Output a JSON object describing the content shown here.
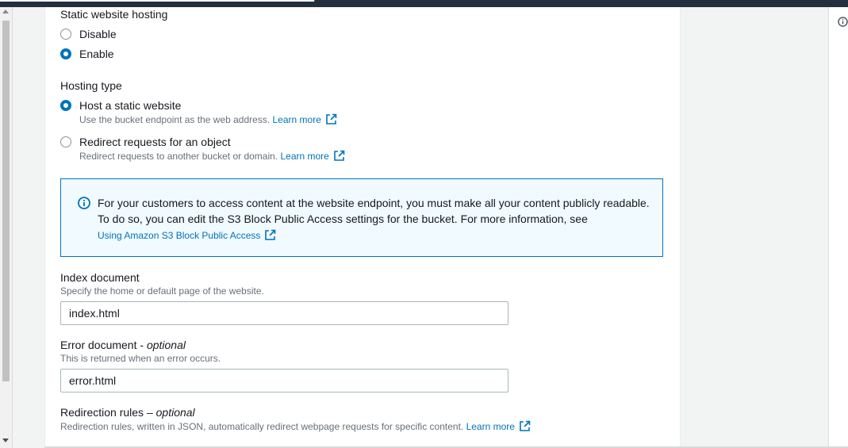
{
  "static_hosting": {
    "title": "Static website hosting",
    "options": [
      {
        "label": "Disable",
        "selected": false
      },
      {
        "label": "Enable",
        "selected": true
      }
    ]
  },
  "hosting_type": {
    "title": "Hosting type",
    "options": [
      {
        "label": "Host a static website",
        "description": "Use the bucket endpoint as the web address.",
        "link": "Learn more",
        "selected": true
      },
      {
        "label": "Redirect requests for an object",
        "description": "Redirect requests to another bucket or domain.",
        "link": "Learn more",
        "selected": false
      }
    ]
  },
  "alert": {
    "text": "For your customers to access content at the website endpoint, you must make all your content publicly readable. To do so, you can edit the S3 Block Public Access settings for the bucket. For more information, see",
    "link": "Using Amazon S3 Block Public Access",
    "icon": "info-icon",
    "color": "#0073bb"
  },
  "index_document": {
    "label": "Index document",
    "description": "Specify the home or default page of the website.",
    "value": "index.html"
  },
  "error_document": {
    "label": "Error document - ",
    "optional": "optional",
    "description": "This is returned when an error occurs.",
    "value": "error.html"
  },
  "redirection_rules": {
    "label": "Redirection rules – ",
    "optional": "optional",
    "description": "Redirection rules, written in JSON, automatically redirect webpage requests for specific content.",
    "link": "Learn more"
  },
  "colors": {
    "link": "#0073bb",
    "text": "#16191f",
    "muted": "#687078",
    "background": "#f2f3f3"
  }
}
